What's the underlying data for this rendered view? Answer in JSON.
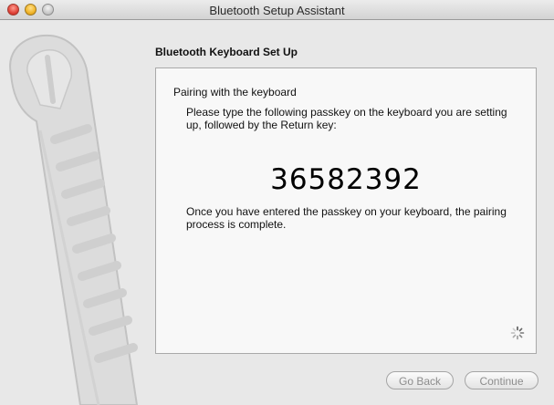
{
  "window": {
    "title": "Bluetooth Setup Assistant"
  },
  "section": {
    "title": "Bluetooth Keyboard Set Up"
  },
  "content": {
    "heading": "Pairing with the keyboard",
    "instructions": "Please type the following passkey on the keyboard you are setting up, followed by the Return key:",
    "passkey": "36582392",
    "completion": "Once you have entered the passkey on your keyboard, the pairing process is complete."
  },
  "buttons": {
    "go_back": "Go Back",
    "continue": "Continue"
  },
  "icons": {
    "close": "close-button",
    "minimize": "minimize-button",
    "zoom": "zoom-button",
    "spinner": "progress-spinner-icon",
    "sidebar_art": "bluetooth-wand-illustration"
  },
  "colors": {
    "close": "#e0443a",
    "minimize": "#f0b429",
    "zoom": "#c9c9c9",
    "window_bg": "#e8e8e8",
    "content_bg": "#f8f8f8"
  }
}
